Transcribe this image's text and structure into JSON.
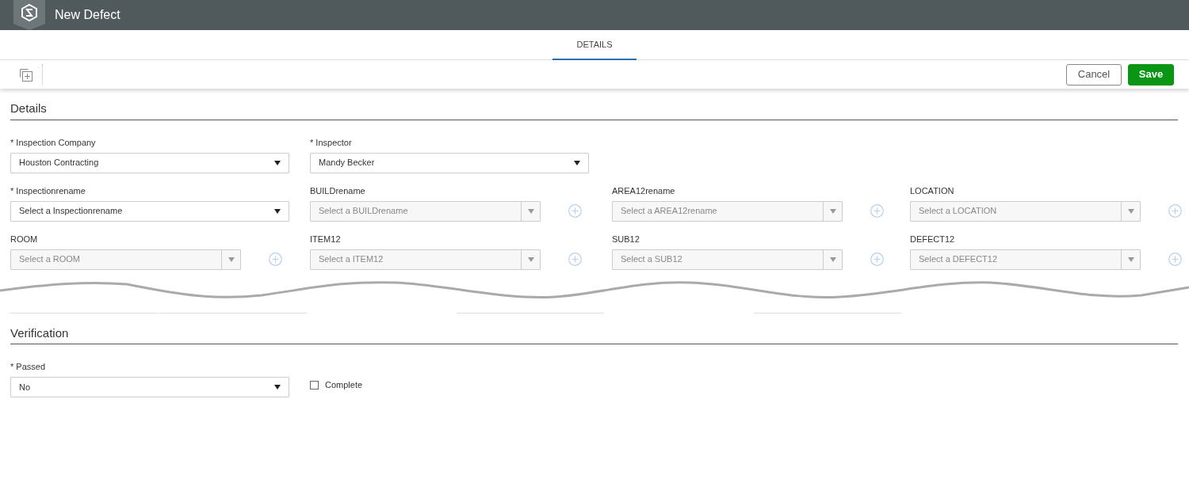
{
  "window": {
    "title": "New Defect"
  },
  "tabs": [
    {
      "label": "DETAILS",
      "selected": true
    }
  ],
  "toolbar": {
    "buttons": [
      {
        "label": "Cancel",
        "kind": "secondary"
      },
      {
        "label": "Save",
        "kind": "primary"
      }
    ]
  },
  "details": {
    "heading": "Details",
    "rows": [
      [
        {
          "label": "* Inspection Company",
          "value": "Houston Contracting",
          "disabled": false,
          "addable": false
        },
        {
          "label": "* Inspector",
          "value": "Mandy Becker",
          "disabled": false,
          "addable": false
        }
      ],
      [
        {
          "label": "* Inspectionrename",
          "value": "Select a Inspectionrename",
          "disabled": false,
          "addable": false
        },
        {
          "label": "BUILDrename",
          "placeholder": "Select a BUILDrename",
          "disabled": true,
          "addable": true
        },
        {
          "label": "AREA12rename",
          "placeholder": "Select a AREA12rename",
          "disabled": true,
          "addable": true
        },
        {
          "label": "LOCATION",
          "placeholder": "Select a LOCATION",
          "disabled": true,
          "addable": true
        }
      ],
      [
        {
          "label": "ROOM",
          "placeholder": "Select a ROOM",
          "disabled": true,
          "addable": true
        },
        {
          "label": "ITEM12",
          "placeholder": "Select a ITEM12",
          "disabled": true,
          "addable": true
        },
        {
          "label": "SUB12",
          "placeholder": "Select a SUB12",
          "disabled": true,
          "addable": true
        },
        {
          "label": "DEFECT12",
          "placeholder": "Select a DEFECT12",
          "disabled": true,
          "addable": true
        }
      ]
    ]
  },
  "verification": {
    "heading": "Verification",
    "fields": [
      {
        "kind": "select",
        "label": "* Passed",
        "value": "No"
      },
      {
        "kind": "checkbox",
        "label": "Complete",
        "checked": false
      }
    ]
  }
}
